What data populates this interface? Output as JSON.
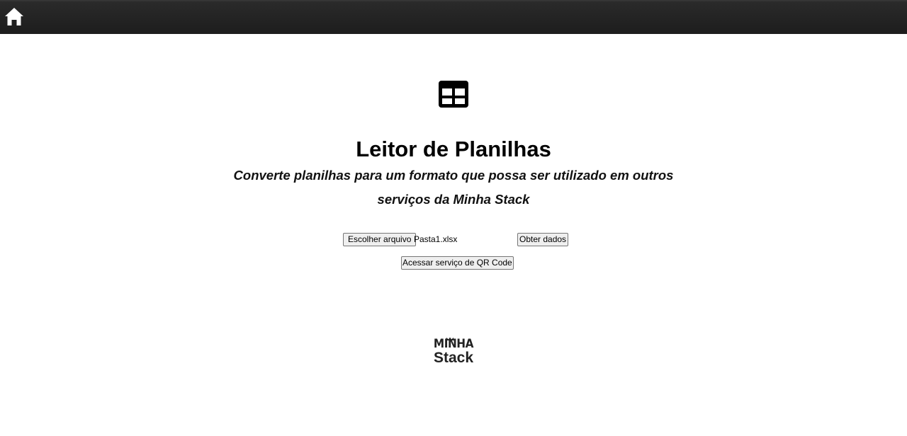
{
  "header": {
    "home_icon": "home-icon"
  },
  "main": {
    "icon": "table-icon",
    "title": "Leitor de Planilhas",
    "subtitle": "Converte planilhas para um formato que possa ser utilizado em outros serviços da Minha Stack"
  },
  "file_input": {
    "button_label": "Escolher arquivo",
    "file_name": "Pasta1.xlsx"
  },
  "actions": {
    "get_data_label": "Obter dados",
    "qr_service_label": "Acessar serviço de QR Code"
  },
  "footer": {
    "logo_top": "MINHA",
    "logo_bottom": "Stack"
  }
}
